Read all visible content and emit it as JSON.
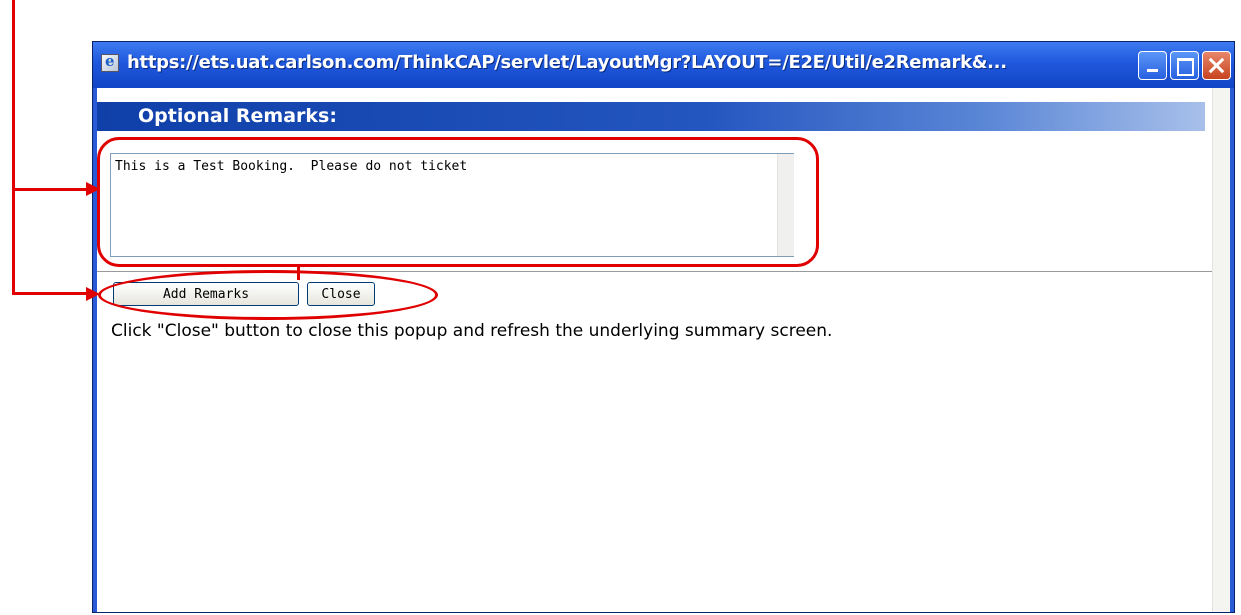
{
  "window": {
    "title": "https://ets.uat.carlson.com/ThinkCAP/servlet/LayoutMgr?LAYOUT=/E2E/Util/e2Remark&..."
  },
  "header": {
    "title": "Optional Remarks:"
  },
  "remarks": {
    "value": "This is a Test Booking.  Please do not ticket"
  },
  "buttons": {
    "add_remarks": "Add Remarks",
    "close": "Close"
  },
  "hint": "Click \"Close\" button to close this popup and refresh the underlying summary screen.",
  "colors": {
    "title_bar": "#1f58dd",
    "header_bar": "#0f3fa8",
    "annotation": "#e00000"
  },
  "icons": [
    "ie-page-icon",
    "minimize-icon",
    "maximize-icon",
    "close-icon"
  ]
}
